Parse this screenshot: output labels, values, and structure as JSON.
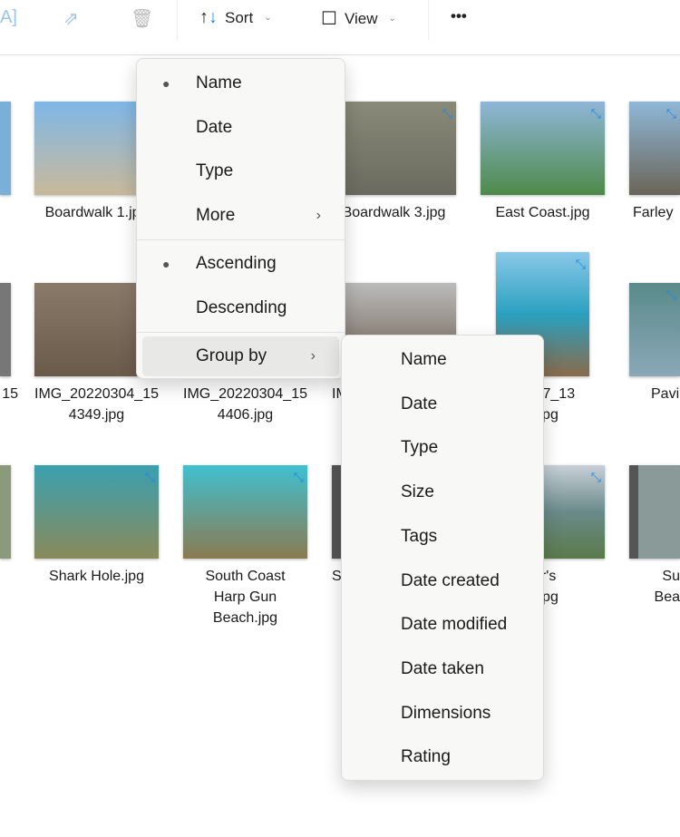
{
  "toolbar": {
    "sort_label": "Sort",
    "view_label": "View",
    "more_label": "•••"
  },
  "files": [
    {
      "label": "Boardwalk 1.jpg",
      "colors": [
        "#7fb7e8",
        "#c9b99a"
      ]
    },
    {
      "label": "Boardwalk 3.jpg",
      "colors": [
        "#8a8a7a",
        "#6a6a5e"
      ]
    },
    {
      "label": "East Coast.jpg",
      "colors": [
        "#8fb6d8",
        "#4f8a4a"
      ]
    },
    {
      "label": "Farley",
      "colors": [
        "#8fb8d8",
        "#6a6458"
      ]
    },
    {
      "label": "IMG_20220304_154349.jpg",
      "line1": "IMG_20220304_15",
      "line2": "4349.jpg",
      "colors": [
        "#8a7a6a",
        "#6a5a4a"
      ]
    },
    {
      "label": "IMG_20220304_154406.jpg",
      "line1": "IMG_20220304_15",
      "line2": "4406.jpg",
      "colors": [
        "#a0a0a0",
        "#5a4a3a"
      ]
    },
    {
      "label": "Pavi",
      "colors": [
        "#5a8a8a",
        "#8aa8b8"
      ]
    },
    {
      "label": "Shark Hole.jpg",
      "colors": [
        "#3aa0b0",
        "#8a8a5a"
      ]
    },
    {
      "label": "South Coast Harp Gun Beach.jpg",
      "line1": "South Coast",
      "line2": "Harp Gun",
      "line3": "Beach.jpg",
      "colors": [
        "#40c0d0",
        "#8a7a50"
      ]
    }
  ],
  "partial_labels": {
    "r2c0": "15",
    "r2c2": "IM",
    "r2c3a": "20307_13",
    "r2c3b": "3.jpg",
    "r3c2": "S",
    "r3c3a": "fer's",
    "r3c3b": "h.jpg",
    "r3c4a": "Su",
    "r3c4b": "Bea"
  },
  "sort_menu": {
    "items": [
      "Name",
      "Date",
      "Type",
      "More"
    ],
    "order": [
      "Ascending",
      "Descending"
    ],
    "group_by": "Group by",
    "selected_sort": "Name",
    "selected_order": "Ascending"
  },
  "group_menu": {
    "items": [
      "Name",
      "Date",
      "Type",
      "Size",
      "Tags",
      "Date created",
      "Date modified",
      "Date taken",
      "Dimensions",
      "Rating"
    ]
  }
}
